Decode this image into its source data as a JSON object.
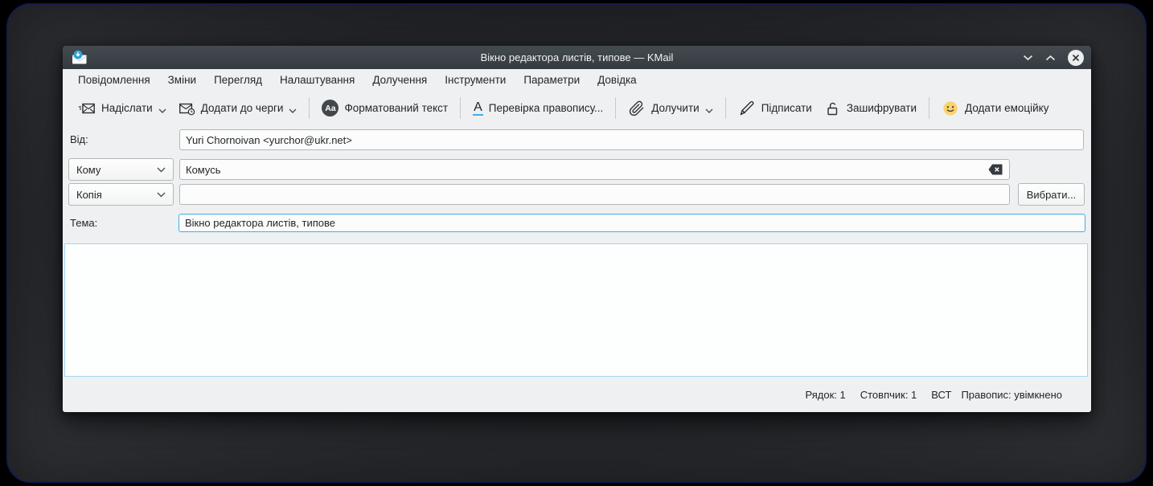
{
  "colors": {
    "accent": "#3daee9",
    "titlebar": "#3c4247",
    "window_bg": "#eff0f1",
    "emoji_yellow": "#f9d36d"
  },
  "titlebar": {
    "title": "Вікно редактора листів, типове — KMail"
  },
  "menubar": {
    "items": [
      "Повідомлення",
      "Зміни",
      "Перегляд",
      "Налаштування",
      "Долучення",
      "Інструменти",
      "Параметри",
      "Довідка"
    ]
  },
  "toolbar": {
    "send": "Надіслати",
    "queue": "Додати до черги",
    "richtext": "Форматований текст",
    "richtext_icon": "Aa",
    "spellcheck": "Перевірка правопису...",
    "spellcheck_icon": "A",
    "attach": "Долучити",
    "sign": "Підписати",
    "encrypt": "Зашифрувати",
    "emoji": "Додати емоційку"
  },
  "form": {
    "from_label": "Від:",
    "from_value": "Yuri Chornoivan <yurchor@ukr.net>",
    "to_selector": "Кому",
    "to_value": "Комусь",
    "cc_selector": "Копія",
    "cc_value": "",
    "select_button_label": "Вибрати...",
    "subject_label": "Тема:",
    "subject_value": "Вікно редактора листів, типове"
  },
  "statusbar": {
    "line": "Рядок: 1",
    "column": "Стовпчик: 1",
    "mode": "ВСТ",
    "spelling": "Правопис: увімкнено"
  }
}
